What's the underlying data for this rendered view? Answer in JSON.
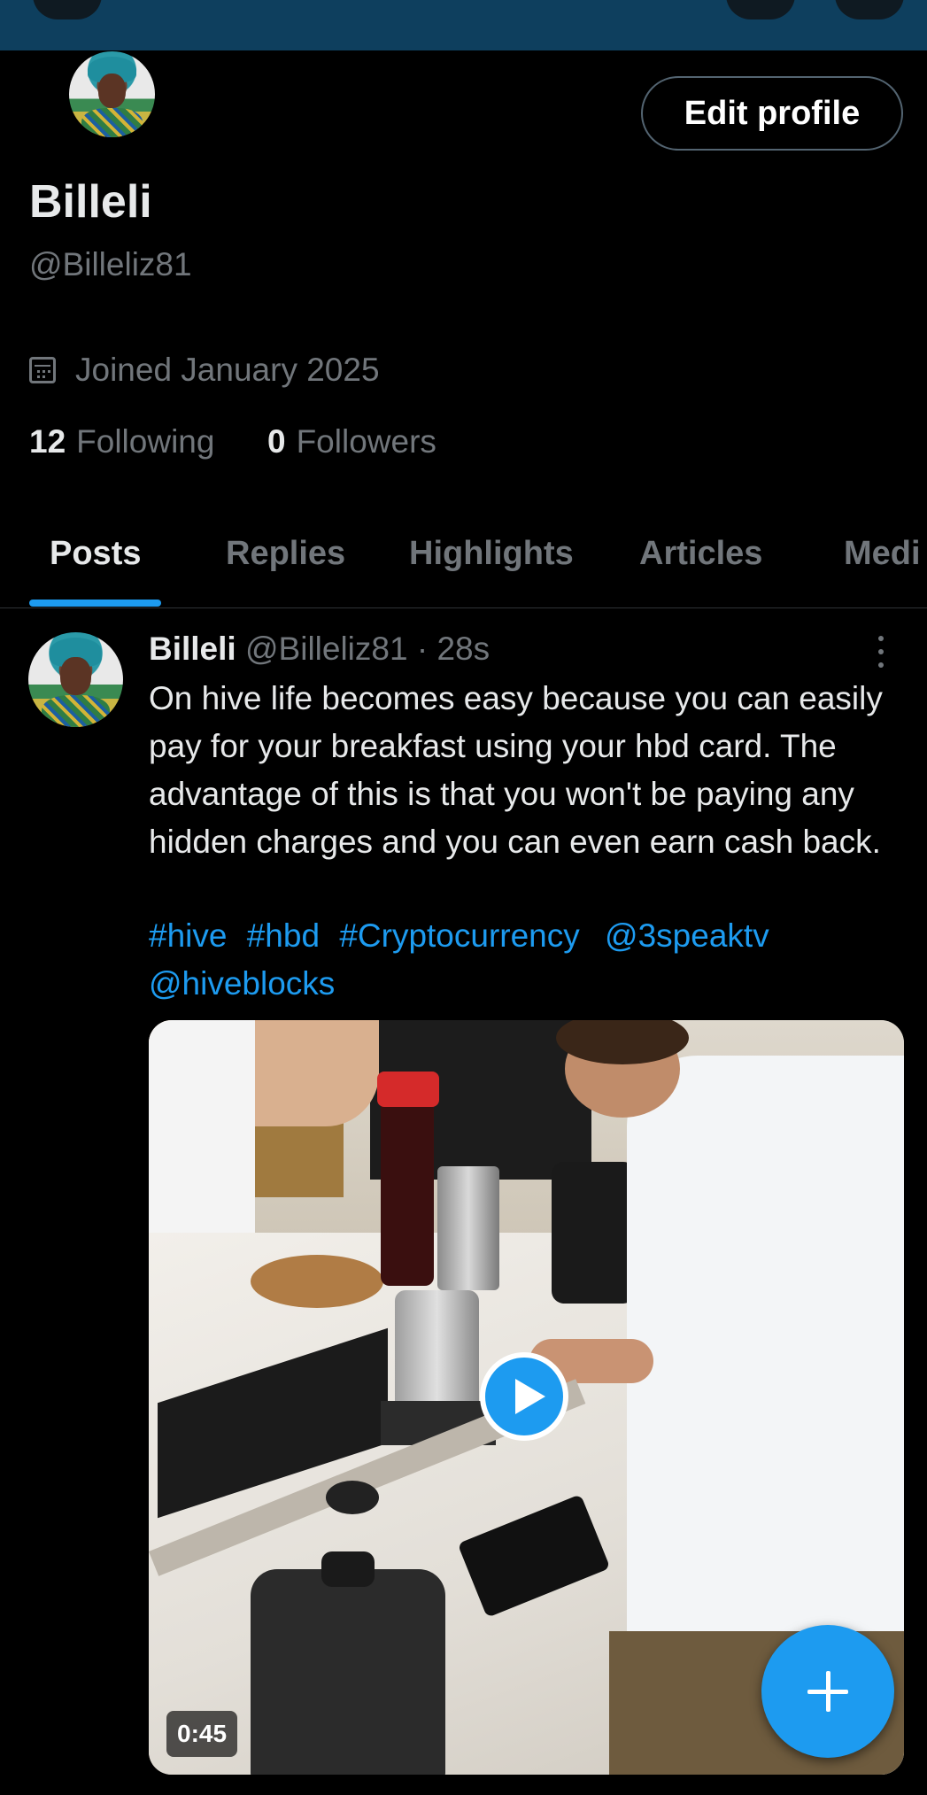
{
  "profile": {
    "name": "Billeli",
    "handle": "@Billeliz81",
    "joined": "Joined January 2025",
    "following_count": "12",
    "following_label": "Following",
    "followers_count": "0",
    "followers_label": "Followers",
    "edit_label": "Edit profile"
  },
  "tabs": [
    {
      "label": "Posts",
      "active": true
    },
    {
      "label": "Replies"
    },
    {
      "label": "Highlights"
    },
    {
      "label": "Articles"
    },
    {
      "label": "Medi"
    }
  ],
  "post": {
    "name": "Billeli",
    "meta": "@Billeliz81 · 28s",
    "text": "On hive life becomes easy because you can easily pay for your breakfast using your hbd card. The advantage of this is that you won't be paying any hidden charges and you can even earn cash back.",
    "tags": [
      "#hive",
      "#hbd",
      "#Cryptocurrency",
      "@3speaktv",
      "@hiveblocks"
    ],
    "video_duration": "0:45"
  },
  "icons": {
    "calendar": "calendar-icon",
    "more": "more-vertical-icon",
    "play": "play-icon",
    "compose": "plus-icon"
  },
  "colors": {
    "accent": "#1d9bf0",
    "muted": "#71767b",
    "banner": "#0e3f5e"
  }
}
